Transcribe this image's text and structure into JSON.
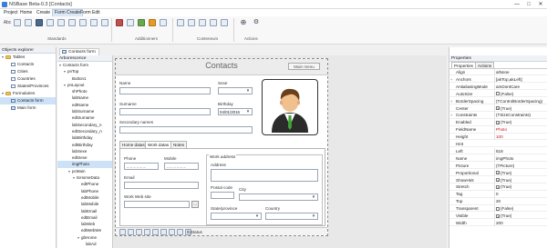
{
  "window": {
    "title": "NSBase Beta-0.3 [Contacts]",
    "controls": [
      "—",
      "□",
      "✕"
    ]
  },
  "menu": [
    "Project",
    "Home",
    "Create",
    "Form Create",
    "Form Edit"
  ],
  "ribbon": {
    "groups": [
      "Standards",
      "Additionners",
      "Conteneurs",
      "Actions"
    ],
    "abc_label": "Abc"
  },
  "explorer": {
    "header": "Objects explorer",
    "tables_label": "Tables",
    "tables": [
      "Contacts",
      "Cities",
      "Countries",
      "States/Provinces"
    ],
    "forms_label": "Formulaires",
    "forms": [
      "Contacts form",
      "Main form"
    ]
  },
  "doc_tab": "Contacts form",
  "arborescence": {
    "header": "Arborescence",
    "items": [
      {
        "label": "Contacts form",
        "indent": 0,
        "toggle": "▾"
      },
      {
        "label": "pnTop",
        "indent": 1,
        "toggle": "▾"
      },
      {
        "label": "Button1",
        "indent": 2,
        "toggle": ""
      },
      {
        "label": "pnLayout",
        "indent": 1,
        "toggle": "▾"
      },
      {
        "label": "shPhoto",
        "indent": 2,
        "toggle": ""
      },
      {
        "label": "labName",
        "indent": 2,
        "toggle": ""
      },
      {
        "label": "edtName",
        "indent": 2,
        "toggle": ""
      },
      {
        "label": "labSurname",
        "indent": 2,
        "toggle": ""
      },
      {
        "label": "edtSurname",
        "indent": 2,
        "toggle": ""
      },
      {
        "label": "labSecondary_n",
        "indent": 2,
        "toggle": ""
      },
      {
        "label": "edtSecondary_n",
        "indent": 2,
        "toggle": ""
      },
      {
        "label": "labBirthday",
        "indent": 2,
        "toggle": ""
      },
      {
        "label": "edtBirthday",
        "indent": 2,
        "toggle": ""
      },
      {
        "label": "labSexe",
        "indent": 2,
        "toggle": ""
      },
      {
        "label": "edtSexe",
        "indent": 2,
        "toggle": ""
      },
      {
        "label": "imgPhoto",
        "indent": 2,
        "toggle": "",
        "selected": true
      },
      {
        "label": "pcMain",
        "indent": 2,
        "toggle": "▾"
      },
      {
        "label": "tsHomeData",
        "indent": 3,
        "toggle": "▾"
      },
      {
        "label": "edtPhone",
        "indent": 4,
        "toggle": ""
      },
      {
        "label": "labPhone",
        "indent": 4,
        "toggle": ""
      },
      {
        "label": "edtMobile",
        "indent": 4,
        "toggle": ""
      },
      {
        "label": "labMobile",
        "indent": 4,
        "toggle": ""
      },
      {
        "label": "labEmail",
        "indent": 4,
        "toggle": ""
      },
      {
        "label": "edtEmail",
        "indent": 4,
        "toggle": ""
      },
      {
        "label": "labWeb",
        "indent": 4,
        "toggle": ""
      },
      {
        "label": "edtWebWe",
        "indent": 4,
        "toggle": ""
      },
      {
        "label": "gbHome",
        "indent": 4,
        "toggle": "▾"
      },
      {
        "label": "labAd",
        "indent": 5,
        "toggle": ""
      },
      {
        "label": "edtAd",
        "indent": 5,
        "toggle": ""
      }
    ]
  },
  "form": {
    "title": "Contacts",
    "main_menu_button": "Main menu",
    "name_label": "Name",
    "sexe_label": "Sexe",
    "surname_label": "Surname",
    "birthday_label": "Birthday",
    "birthday_value": "04/01/2016",
    "secondary_names_label": "Secondary names",
    "tabs": [
      "Home datas",
      "Work datas",
      "Notes"
    ],
    "active_tab": 1,
    "phone_label": "Phone",
    "mobile_label": "Mobile",
    "phone_mask": "_ _ _ _ _ _",
    "mobile_mask": "_ _ _ _ _ _",
    "email_label": "Email",
    "web_label": "Work Web site",
    "web_button": "...",
    "work_address_group": "Work address",
    "address_label": "Address",
    "postal_label": "Postal code",
    "city_label": "City",
    "state_label": "State/province",
    "country_label": "Country",
    "nav_status": "tbStatus"
  },
  "properties": {
    "header": "Properties",
    "tabs": [
      "Properties",
      "Actions"
    ],
    "rows": [
      {
        "name": "Align",
        "value": "alNone"
      },
      {
        "name": "Anchors",
        "value": "[akTop,akLeft]",
        "expand": "+"
      },
      {
        "name": "AntialiasingMode",
        "value": "amDontCare"
      },
      {
        "name": "AutoSize",
        "value": "(False)",
        "check": true,
        "checked": false
      },
      {
        "name": "BorderSpacing",
        "value": "(TControlBorderSpacing)",
        "expand": "+"
      },
      {
        "name": "Center",
        "value": "(True)",
        "check": true,
        "checked": true
      },
      {
        "name": "Constraints",
        "value": "(TSizeConstraints)",
        "expand": "+"
      },
      {
        "name": "Enabled",
        "value": "(True)",
        "check": true,
        "checked": true
      },
      {
        "name": "FieldName",
        "value": "Photo",
        "red": true
      },
      {
        "name": "Height",
        "value": "100",
        "red": true
      },
      {
        "name": "Hint",
        "value": ""
      },
      {
        "name": "Left",
        "value": "518"
      },
      {
        "name": "Name",
        "value": "imgPhoto"
      },
      {
        "name": "Picture",
        "value": "(TPicture)"
      },
      {
        "name": "Proportional",
        "value": "(True)",
        "check": true,
        "checked": true
      },
      {
        "name": "ShowHint",
        "value": "(True)",
        "check": true,
        "checked": true
      },
      {
        "name": "Stretch",
        "value": "(True)",
        "check": true,
        "checked": true
      },
      {
        "name": "Tag",
        "value": "0"
      },
      {
        "name": "Top",
        "value": "20"
      },
      {
        "name": "Transparent",
        "value": "(False)",
        "check": true,
        "checked": false
      },
      {
        "name": "Visible",
        "value": "(True)",
        "check": true,
        "checked": true
      },
      {
        "name": "Width",
        "value": "200"
      }
    ]
  },
  "colors": {
    "accent": "#3c7fd6",
    "selection": "#cde2f7",
    "required_value": "#c0141c"
  }
}
